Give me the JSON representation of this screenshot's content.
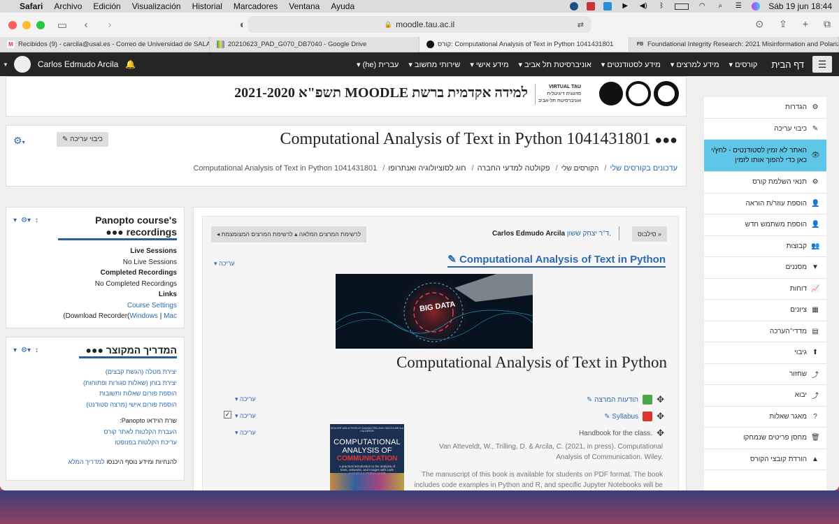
{
  "macos": {
    "app": "Safari",
    "menus": [
      "Archivo",
      "Edición",
      "Visualización",
      "Historial",
      "Marcadores",
      "Ventana",
      "Ayuda"
    ],
    "datetime": "Sáb 19 jun  18:44"
  },
  "browser": {
    "url": "moodle.tau.ac.il",
    "tabs": [
      "Recibidos (9) - carcila@usal.es - Correo de Universidad de SALAM...",
      "20210623_PAD_G070_DB7040 - Google Drive",
      "קורס: Computational Analysis of Text in Python 1041431801",
      "Foundational Integrity Research: 2021 Misinformation and Polarizat..."
    ]
  },
  "moodle_nav": {
    "user": "Carlos Edmudo Arcila",
    "home": "דף הבית",
    "menu": [
      "קורסים",
      "מידע למרצים",
      "מידע לסטודנטים",
      "אוניברסיטת תל אביב",
      "מידע אישי",
      "שירותי מחשוב",
      "עברית (he)"
    ]
  },
  "banner": {
    "title": "למידה אקדמית ברשת MOODLE תשפ\"א 2021-2020",
    "logo_line1": "VIRTUAL TAU",
    "logo_line2": "פדגוגיה דיגיטלית",
    "logo_line3": "אוניברסיטת תל-אביב"
  },
  "course_header": {
    "title": "Computational Analysis of Text in Python 1041431801",
    "edit_button": "כיבוי עריכה",
    "breadcrumbs": [
      "עדכונים בקורסים שלי",
      "הקורסים שלי",
      "פקולטה למדעי החברה",
      "חוג לסוציולוגיה ואנתרופו",
      "Computational Analysis of Text in Python 1041431801"
    ]
  },
  "panopto_block": {
    "title": "Panopto course's recordings",
    "live_label": "Live Sessions",
    "live_value": "No Live Sessions",
    "completed_label": "Completed Recordings",
    "completed_value": "No Completed Recordings",
    "links_label": "Links",
    "course_settings": "Course Settings",
    "download_prefix": "(Download Recorder(",
    "windows": "Windows",
    "sep": " | ",
    "mac": "Mac"
  },
  "guide_block": {
    "title": "המדריך המקוצר",
    "links": [
      "יצירת מטלה (הגשת קבצים)",
      "יצירת בוחן (שאלות סגורות ופתוחות)",
      "הוספת פורום שאלות ותשובות",
      "הוספת פורום אישי (מרצה סטודנט)"
    ],
    "video_label": "שרת הוידאו Panopto:",
    "video_links": [
      "העברת הקלטות לאתר קורס",
      "עריכת הקלטות בפנופטו"
    ],
    "footer_text": "להנחיות ומידע נוסף היכנסו ",
    "footer_link": "למדריך המלא"
  },
  "main": {
    "syllabus_btn": "סילבוס »",
    "lecturer_link": "ד\"ר יצחק ששון,",
    "lecturer_name": "Carlos Edmudo Arcila",
    "list_btn": "לרשימת המרצים המלאה ▴ לרשימת המרצים המצומצמת",
    "section_title": "Computational Analysis of Text in Python",
    "edit": "עריכה",
    "image_text": "BIG DATA",
    "big_title": "Computational Analysis of Text in Python",
    "activities": [
      {
        "name": "הודעות המרצה",
        "color": "#4ca64c"
      },
      {
        "name": "Syllabus",
        "color": "#d9352c"
      },
      {
        "name": "Handbook for the class.",
        "color": ""
      }
    ],
    "book_cover": {
      "authors": "WOUTER VAN ATTEVELDT  DAMIAN TRILLING  CARLOS ARCILA CALDERÓN",
      "title1": "COMPUTATIONAL",
      "title2": "ANALYSIS OF",
      "title3": "COMMUNICATION",
      "subtitle": "A practical introduction to the analysis of texts, networks, and images with code examples in Python and R"
    },
    "citation": "Van Atteveldt, W., Trilling, D. & Arcila, C. (2021, in press). Computational Analysis of Communication. Wiley.",
    "paragraph": "The manuscript of this book is available for students on PDF format. The book includes code examples in Python and R, and specific Jupyter Notebooks will be provided for the class activities. As publication is"
  },
  "sidebar": {
    "items": [
      {
        "label": "הגדרות",
        "icon": "⚙"
      },
      {
        "label": "כיבוי עריכה",
        "icon": "✎"
      },
      {
        "label": "האתר לא זמין לסטודנטים - לחץ/י כאן כדי להפוך אותו לזמין",
        "icon": "👁",
        "highlight": true
      },
      {
        "label": "תנאי השלמת קורס",
        "icon": "⚙"
      },
      {
        "label": "הוספת עוזר/ת הוראה",
        "icon": "👤"
      },
      {
        "label": "הוספת משתמש חדש",
        "icon": "👤"
      },
      {
        "label": "קבוצות",
        "icon": "👥"
      },
      {
        "label": "מסננים",
        "icon": "▼"
      },
      {
        "label": "דוחות",
        "icon": "📈"
      },
      {
        "label": "ציונים",
        "icon": "▦"
      },
      {
        "label": "מדדי־הערכה",
        "icon": "▤"
      },
      {
        "label": "גיבוי",
        "icon": "⬆"
      },
      {
        "label": "שחזור",
        "icon": "⤴"
      },
      {
        "label": "יבוא",
        "icon": "⤴"
      },
      {
        "label": "מאגר שאלות",
        "icon": "?"
      },
      {
        "label": "מחסן פריטים שנמחקו",
        "icon": "🗑"
      },
      {
        "label": "הורדת קובצי הקורס",
        "icon": "▲"
      }
    ]
  }
}
